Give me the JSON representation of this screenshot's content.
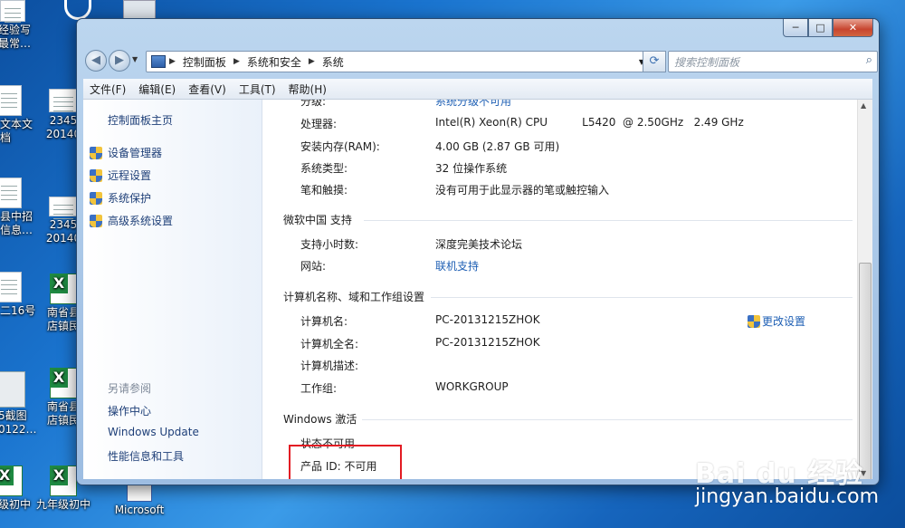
{
  "desktop": {
    "icons": [
      {
        "label": "经验写\n最常…"
      },
      {
        "label": "重"
      },
      {
        "label": "文本文\n档"
      },
      {
        "label": "2345\n20140"
      },
      {
        "label": "县中招\n信息…"
      },
      {
        "label": "2345\n20140"
      },
      {
        "label": "二16号"
      },
      {
        "label": "南省县\n店镇民"
      },
      {
        "label": "5截图\n0122…"
      },
      {
        "label": "南省县\n店镇民"
      },
      {
        "label": "级初中"
      },
      {
        "label": "九年级初中"
      },
      {
        "label": "Microsoft"
      }
    ]
  },
  "window": {
    "controls": {
      "min": "─",
      "max": "□",
      "close": "✕"
    },
    "nav": {
      "back_icon": "◀",
      "forward_icon": "▶",
      "breadcrumb": [
        "控制面板",
        "系统和安全",
        "系统"
      ],
      "search_placeholder": "搜索控制面板"
    },
    "menubar": [
      "文件(F)",
      "编辑(E)",
      "查看(V)",
      "工具(T)",
      "帮助(H)"
    ],
    "left_pane": {
      "home": "控制面板主页",
      "tasks": [
        "设备管理器",
        "远程设置",
        "系统保护",
        "高级系统设置"
      ],
      "see_also_title": "另请参阅",
      "see_also": [
        "操作中心",
        "Windows Update",
        "性能信息和工具"
      ]
    },
    "system": {
      "rating_label": "分级:",
      "rating_value": "系统分级不可用",
      "processor_label": "处理器:",
      "processor_value": "Intel(R) Xeon(R) CPU          L5420  @ 2.50GHz   2.49 GHz",
      "ram_label": "安装内存(RAM):",
      "ram_value": "4.00 GB (2.87 GB 可用)",
      "type_label": "系统类型:",
      "type_value": "32 位操作系统",
      "pen_label": "笔和触摸:",
      "pen_value": "没有可用于此显示器的笔或触控输入"
    },
    "support": {
      "title": "微软中国 支持",
      "hours_label": "支持小时数:",
      "hours_value": "深度完美技术论坛",
      "site_label": "网站:",
      "site_value": "联机支持"
    },
    "computer": {
      "title": "计算机名称、域和工作组设置",
      "name_label": "计算机名:",
      "name_value": "PC-20131215ZHOK",
      "full_label": "计算机全名:",
      "full_value": "PC-20131215ZHOK",
      "desc_label": "计算机描述:",
      "workgroup_label": "工作组:",
      "workgroup_value": "WORKGROUP",
      "change_settings": "更改设置"
    },
    "activation": {
      "title": "Windows 激活",
      "status": "状态不可用",
      "product_id": "产品 ID: 不可用"
    }
  },
  "watermark": {
    "logo": "Bai du 经验",
    "url": "jingyan.baidu.com"
  },
  "colors": {
    "highlight_box": "#e31b23",
    "link": "#1e5fb4"
  }
}
